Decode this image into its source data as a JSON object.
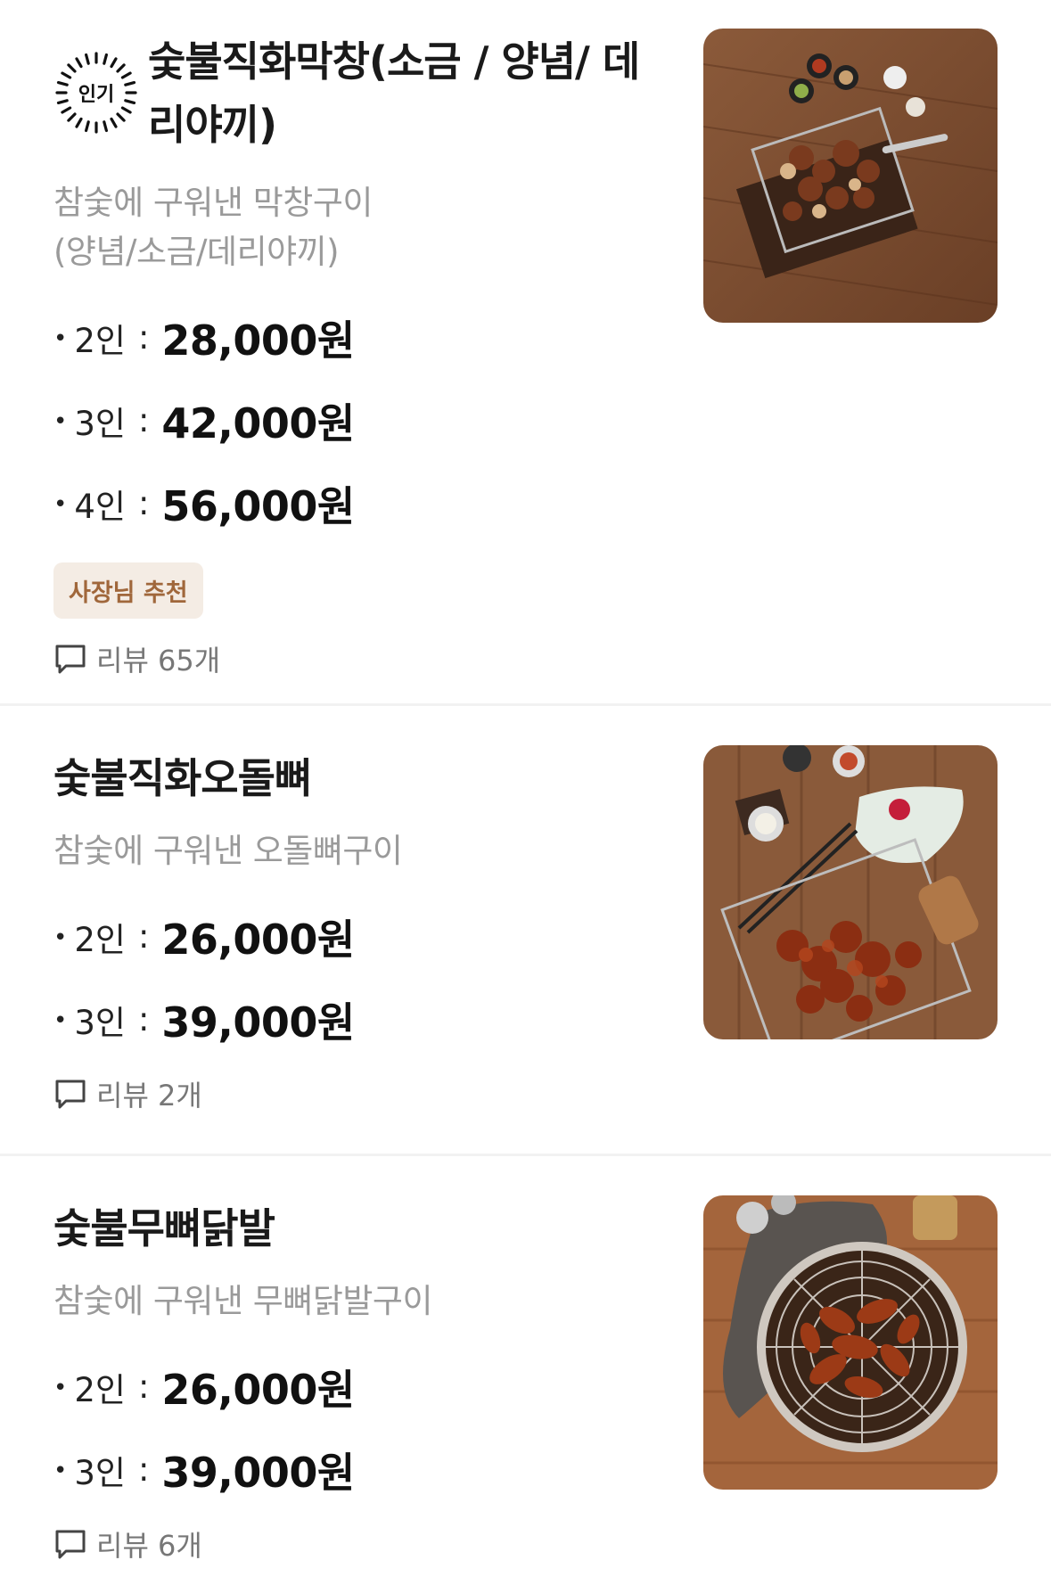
{
  "colors": {
    "title": "#1a1a1a",
    "description": "#9a9a9a",
    "tag_bg": "#f4ece4",
    "tag_text": "#a0673b",
    "review_text": "#777777",
    "divider": "#f2f2f2"
  },
  "menu": [
    {
      "badge": "인기",
      "badge_icon": "popular-badge-icon",
      "title": "숯불직화막창(소금 / 양념/ 데리야끼)",
      "description": "참숯에 구워낸 막창구이\n(양념/소금/데리야끼)",
      "prices": [
        {
          "bullet": "•",
          "people": "2인",
          "sep": ":",
          "price": "28,000원"
        },
        {
          "bullet": "•",
          "people": "3인",
          "sep": ":",
          "price": "42,000원"
        },
        {
          "bullet": "•",
          "people": "4인",
          "sep": ":",
          "price": "56,000원"
        }
      ],
      "tag": "사장님 추천",
      "review": "리뷰 65개",
      "review_icon": "chat-bubble-icon",
      "image_alt": "grilled-makchang-photo"
    },
    {
      "title": "숯불직화오돌뼈",
      "description": "참숯에 구워낸 오돌뼈구이",
      "prices": [
        {
          "bullet": "•",
          "people": "2인",
          "sep": ":",
          "price": "26,000원"
        },
        {
          "bullet": "•",
          "people": "3인",
          "sep": ":",
          "price": "39,000원"
        }
      ],
      "review": "리뷰 2개",
      "review_icon": "chat-bubble-icon",
      "image_alt": "grilled-odolbbyeo-photo"
    },
    {
      "title": "숯불무뼈닭발",
      "description": "참숯에 구워낸 무뼈닭발구이",
      "prices": [
        {
          "bullet": "•",
          "people": "2인",
          "sep": ":",
          "price": "26,000원"
        },
        {
          "bullet": "•",
          "people": "3인",
          "sep": ":",
          "price": "39,000원"
        }
      ],
      "review": "리뷰 6개",
      "review_icon": "chat-bubble-icon",
      "image_alt": "boneless-chicken-feet-photo"
    }
  ]
}
